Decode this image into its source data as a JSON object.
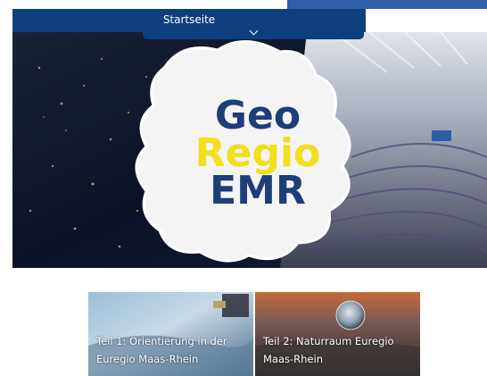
{
  "header": {
    "title": "Startseite",
    "next_icon": "chevron-right-icon",
    "collapse_icon": "chevron-down-icon"
  },
  "hero": {
    "logo_line1": "Geo",
    "logo_line2": "Regio",
    "logo_line3": "EMR"
  },
  "tiles": [
    {
      "label": "Teil 1: Orientierung in der Euregio Maas-Rhein"
    },
    {
      "label": "Teil 2: Naturraum Euregio Maas-Rhein"
    }
  ],
  "colors": {
    "nav": "#0d3f7e",
    "top_strip": "#2f5fa8",
    "logo_blue": "#1e3e7a",
    "logo_yellow": "#f0df1a"
  }
}
